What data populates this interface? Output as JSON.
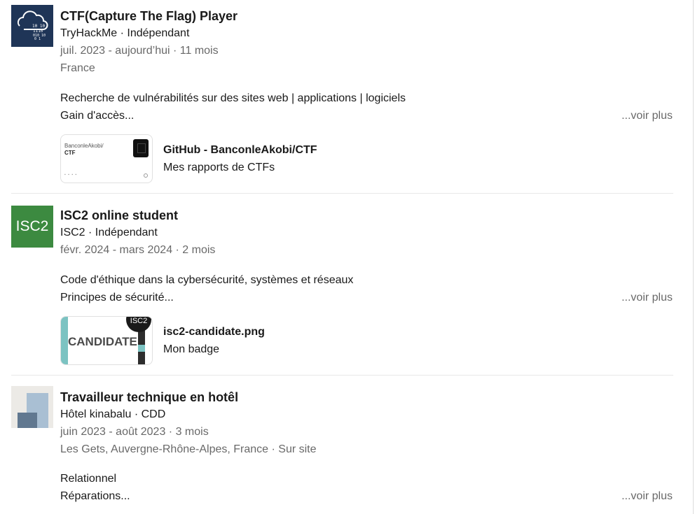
{
  "entries": [
    {
      "logo_icon": "cloud-binary-icon",
      "title": "CTF(Capture The Flag) Player",
      "org": "TryHackMe · Indépendant",
      "dates": "juil. 2023 - aujourd’hui · 11 mois",
      "location": "France",
      "desc_line1": "Recherche de vulnérabilités sur des sites web | applications | logiciels",
      "desc_line2": "Gain d'accès...",
      "see_more": "...voir plus",
      "media": {
        "thumb_owner": "BanconleAkobi/",
        "thumb_repo": "CTF",
        "title": "GitHub - BanconleAkobi/CTF",
        "subtitle": "Mes rapports de CTFs"
      }
    },
    {
      "logo_text": "ISC2",
      "title": "ISC2 online student",
      "org": "ISC2 · Indépendant",
      "dates": "févr. 2024 - mars 2024 · 2 mois",
      "desc_line1": "Code d'éthique dans la cybersécurité, systèmes et réseaux",
      "desc_line2": "Principes de sécurité...",
      "see_more": "...voir plus",
      "media": {
        "thumb_text": "CANDIDATE",
        "thumb_circle": "ISC2",
        "title": "isc2-candidate.png",
        "subtitle": "Mon badge"
      }
    },
    {
      "logo_icon": "company-placeholder-icon",
      "title": "Travailleur technique en hotêl",
      "org": "Hôtel kinabalu · CDD",
      "dates": "juin 2023 - août 2023 · 3 mois",
      "location": "Les Gets, Auvergne-Rhône-Alpes, France · Sur site",
      "desc_line1": "Relationnel",
      "desc_line2": "Réparations...",
      "see_more": "...voir plus"
    }
  ]
}
